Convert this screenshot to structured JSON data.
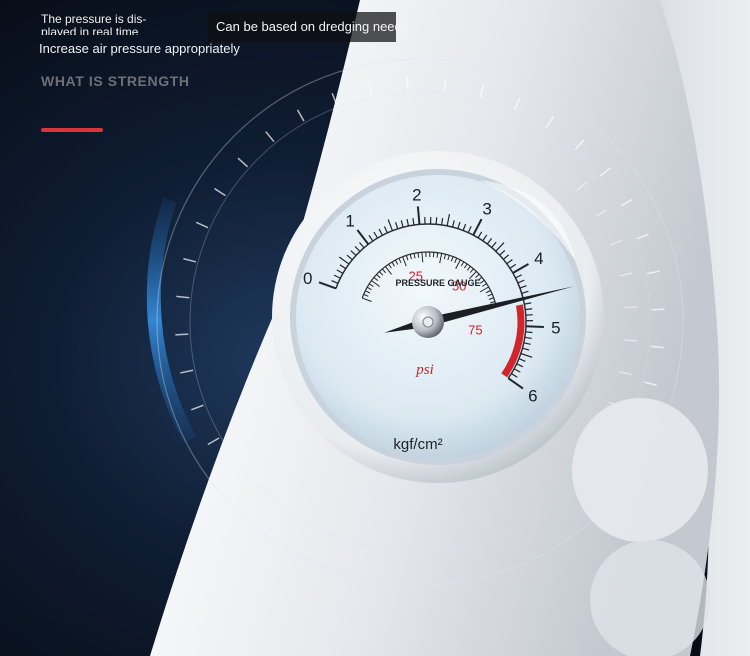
{
  "texts": {
    "realtime_note": "The pressure is dis-\nplayed in real time",
    "dredging_note": "Can be based on dredging needs",
    "increase_note": "Increase air pressure appropriately",
    "heading": "WHAT IS STRENGTH"
  },
  "gauge": {
    "brand_label": "PRESSURE GAUGE",
    "unit_label": "kgf/cm²",
    "psi_label": "psi",
    "kgf_ticks": [
      "0",
      "1",
      "2",
      "3",
      "4",
      "5",
      "6"
    ],
    "psi_ticks": [
      "25",
      "50",
      "75"
    ],
    "needle_value_kgf": 4.5,
    "red_zone_kgf": [
      4.6,
      6
    ]
  },
  "colors": {
    "accent": "#d9363b",
    "background_dark": "#0b1424",
    "glow_blue": "#2a86e0",
    "body_white": "#f0f2f5"
  }
}
